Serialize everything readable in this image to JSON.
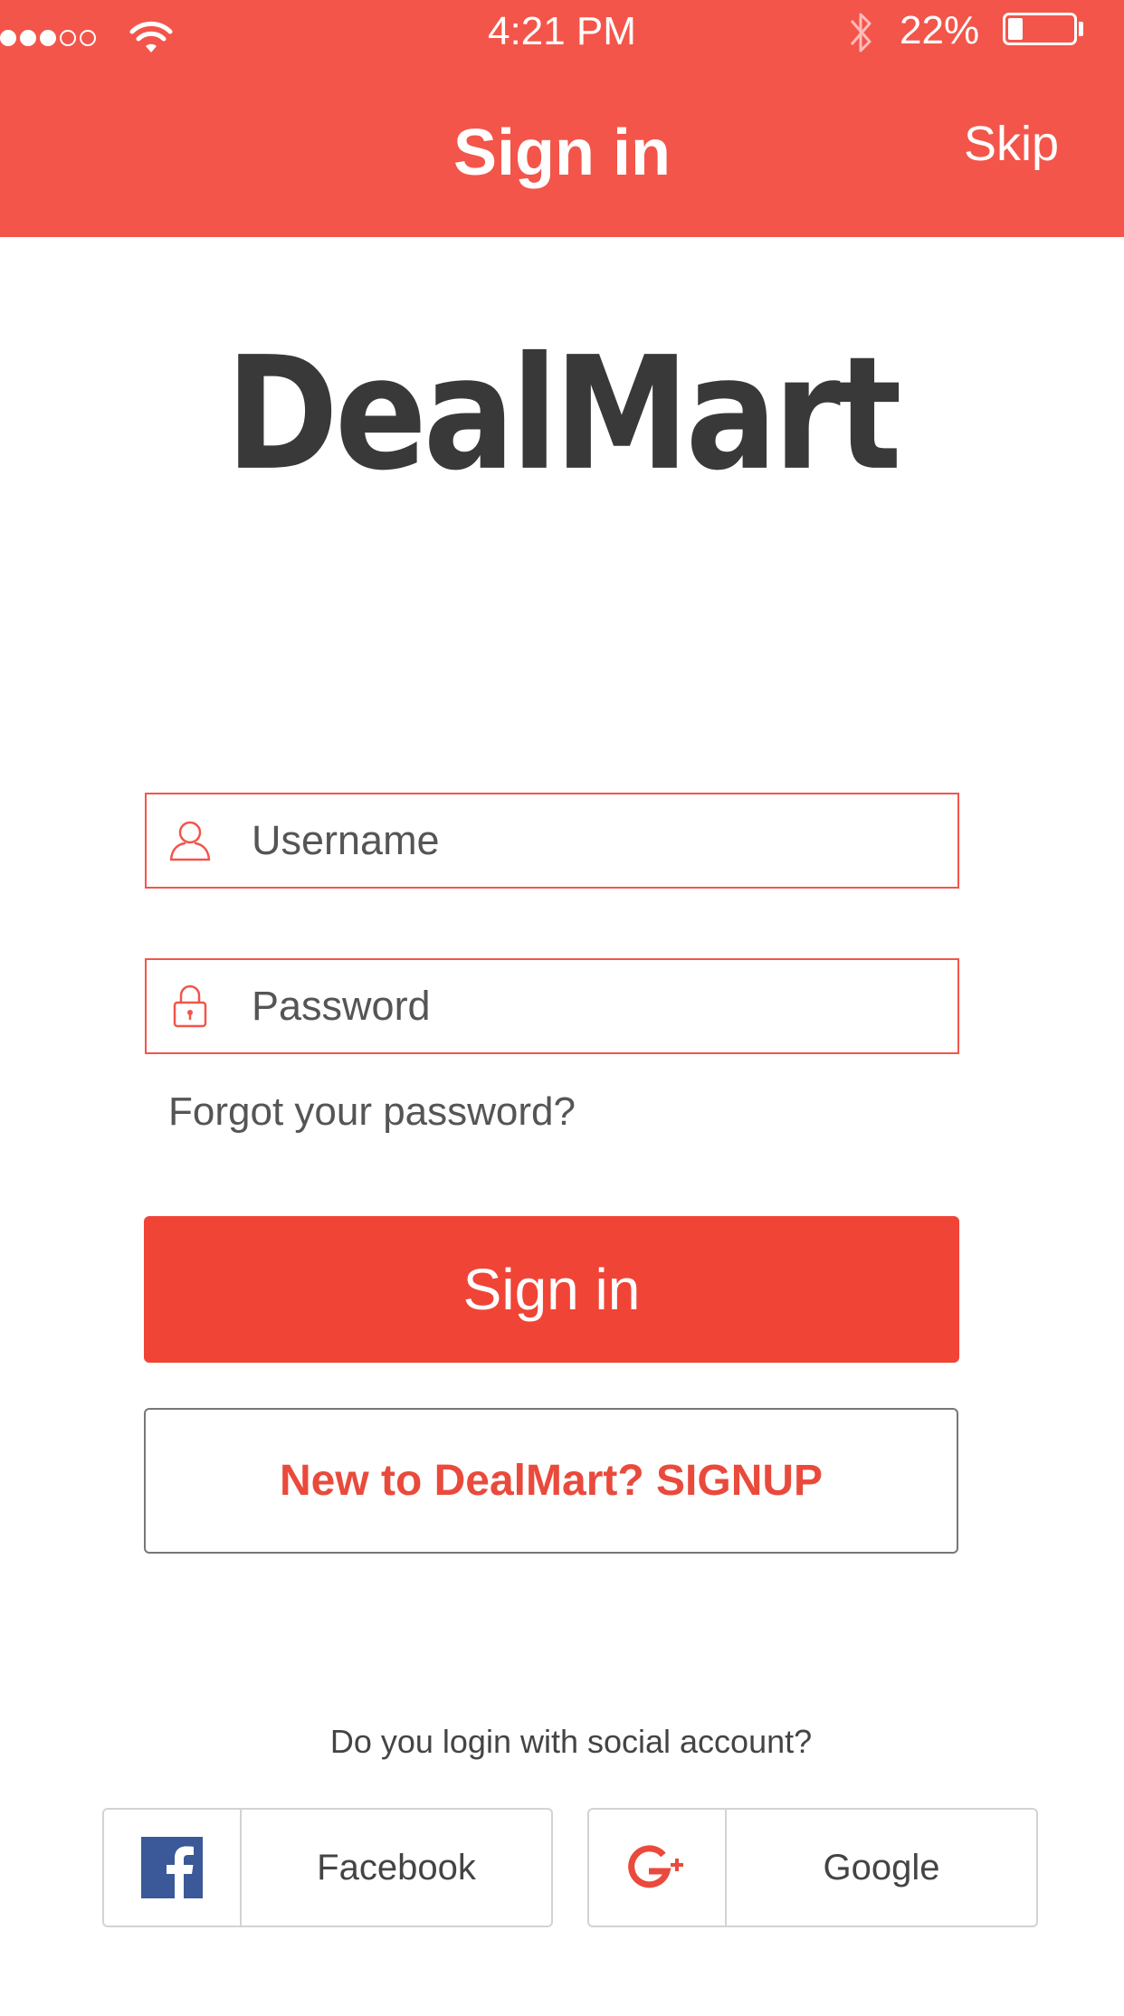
{
  "status_bar": {
    "time": "4:21 PM",
    "battery_percent": "22%",
    "signal_bars_filled": 3,
    "signal_bars_total": 5
  },
  "header": {
    "title": "Sign in",
    "skip_label": "Skip"
  },
  "logo": {
    "text": "DealMart"
  },
  "form": {
    "username_placeholder": "Username",
    "password_placeholder": "Password",
    "forgot_label": "Forgot your password?",
    "signin_label": "Sign in",
    "signup_label": "New to DealMart? SIGNUP"
  },
  "social": {
    "prompt": "Do you login with social account?",
    "facebook_label": "Facebook",
    "google_label": "Google"
  },
  "colors": {
    "header_bg": "#f3554a",
    "signin_button_bg": "#f04437",
    "signup_text": "#e94a3c",
    "facebook_blue": "#3b5998",
    "google_red": "#e94a3c"
  },
  "icons": {
    "username": "user-icon",
    "password": "lock-icon",
    "facebook": "facebook-icon",
    "google": "google-plus-icon"
  }
}
